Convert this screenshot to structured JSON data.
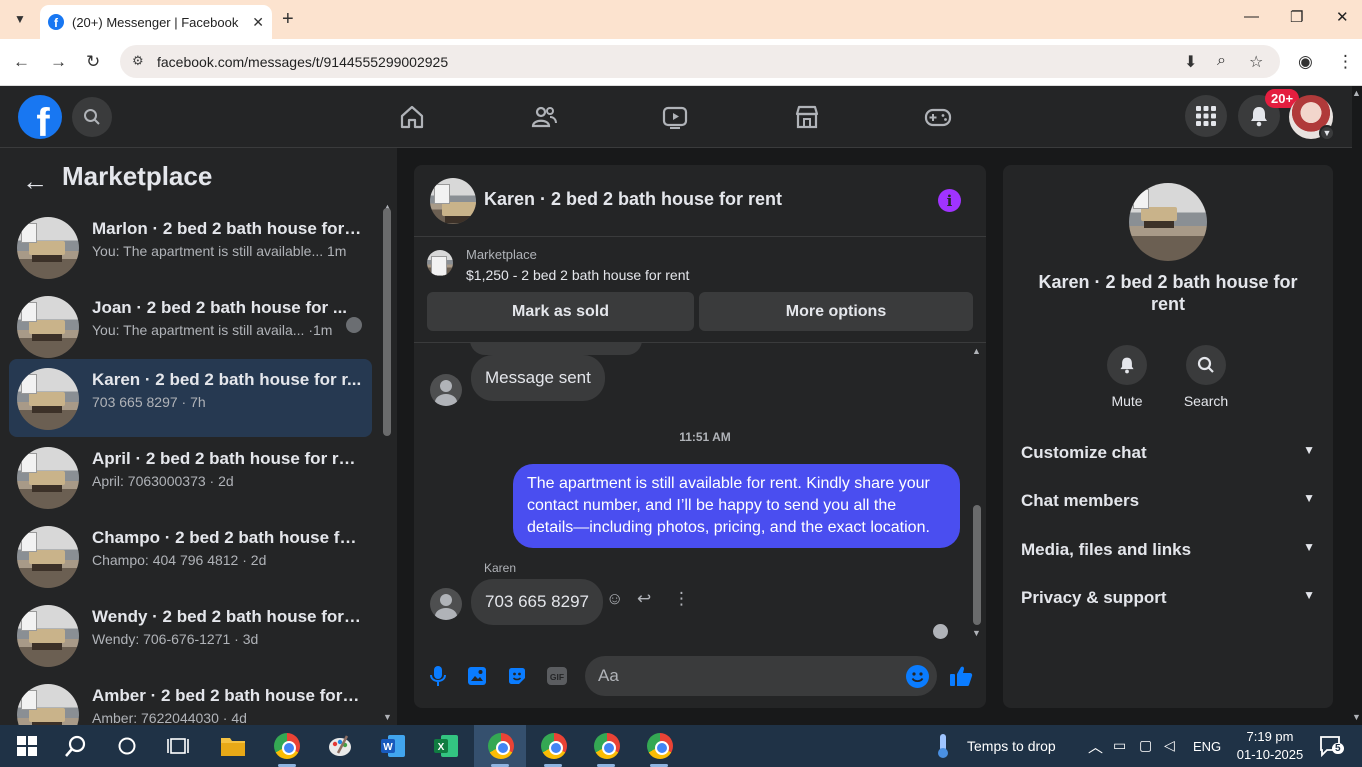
{
  "browser": {
    "tab_title": "(20+) Messenger | Facebook",
    "url": "facebook.com/messages/t/9144555299002925"
  },
  "header": {
    "notification_badge": "20+"
  },
  "sidebar": {
    "title": "Marketplace",
    "conversations": [
      {
        "name": "Marlon · 2 bed 2 bath house for ...",
        "snippet": "You: The apartment is still available... 1m"
      },
      {
        "name": "Joan · 2 bed 2 bath house for ...",
        "snippet": "You: The apartment is still availa... ·1m"
      },
      {
        "name": "Karen · 2 bed 2 bath house for r...",
        "snippet": "703 665 8297 · 7h"
      },
      {
        "name": "April · 2 bed 2 bath house for rent",
        "snippet": "April: 7063000373 · 2d"
      },
      {
        "name": "Champo · 2 bed 2 bath house fo...",
        "snippet": "Champo: 404 796 4812 · 2d"
      },
      {
        "name": "Wendy · 2 bed 2 bath house for ...",
        "snippet": "Wendy: 706-676-1271 · 3d"
      },
      {
        "name": "Amber · 2 bed 2 bath house for r...",
        "snippet": "Amber: 7622044030 · 4d"
      }
    ]
  },
  "chat": {
    "title": "Karen · 2 bed 2 bath house for rent",
    "marketplace_label": "Marketplace",
    "listing": "$1,250 - 2 bed 2 bath house for rent",
    "mark_sold": "Mark as sold",
    "more_options": "More options",
    "msg_sent": "Message sent",
    "timestamp": "11:51 AM",
    "outgoing": "The apartment is still available for rent. Kindly share your contact number, and I’ll be happy to send you all the details—including photos, pricing, and the exact location.",
    "sender": "Karen",
    "incoming": "703 665 8297",
    "composer_placeholder": "Aa"
  },
  "info": {
    "title": "Karen · 2 bed 2 bath house for rent",
    "mute": "Mute",
    "search": "Search",
    "rows": [
      "Customize chat",
      "Chat members",
      "Media, files and links",
      "Privacy & support"
    ]
  },
  "taskbar": {
    "weather": "Temps to drop",
    "lang": "ENG",
    "time": "7:19 pm",
    "date": "01-10-2025",
    "notif_count": "5"
  },
  "colors": {
    "fb_blue": "#1877f2",
    "outgoing_bubble": "#4a4ef0",
    "info_purple": "#a033ff",
    "badge_red": "#e41e3f"
  }
}
